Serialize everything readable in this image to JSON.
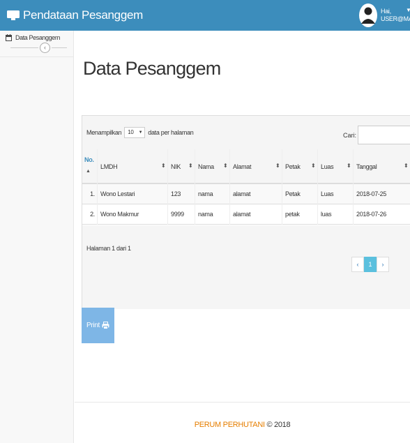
{
  "app": {
    "title": "Pendataan Pesanggem"
  },
  "user": {
    "greeting": "Hai,",
    "email": "USER@MAIL.C..."
  },
  "sidebar": {
    "items": [
      {
        "label": "Data Pesanggem",
        "icon": "calendar-icon"
      }
    ]
  },
  "page": {
    "title": "Data Pesanggem"
  },
  "table_controls": {
    "show_prefix": "Menampilkan",
    "page_size": "10",
    "show_suffix": "data per halaman",
    "search_label": "Cari:",
    "search_value": ""
  },
  "table": {
    "columns": [
      "No.",
      "LMDH",
      "NIK",
      "Nama",
      "Alamat",
      "Petak",
      "Luas",
      "Tanggal"
    ],
    "rows": [
      [
        "1.",
        "Wono Lestari",
        "123",
        "nama",
        "alamat",
        "Petak",
        "Luas",
        "2018-07-25"
      ],
      [
        "2.",
        "Wono Makmur",
        "9999",
        "nama",
        "alamat",
        "petak",
        "luas",
        "2018-07-26"
      ]
    ]
  },
  "pagination": {
    "info": "Halaman 1 dari 1",
    "prev": "‹",
    "current": "1",
    "next": "›"
  },
  "actions": {
    "print_label": "Print"
  },
  "footer": {
    "brand": "PERUM PERHUTANI",
    "copyright": " © 2018"
  },
  "colors": {
    "navbar": "#3c8dbc",
    "accent_orange": "#e67e00",
    "page_active": "#5bc0de",
    "print_button": "#7eb6e6"
  }
}
